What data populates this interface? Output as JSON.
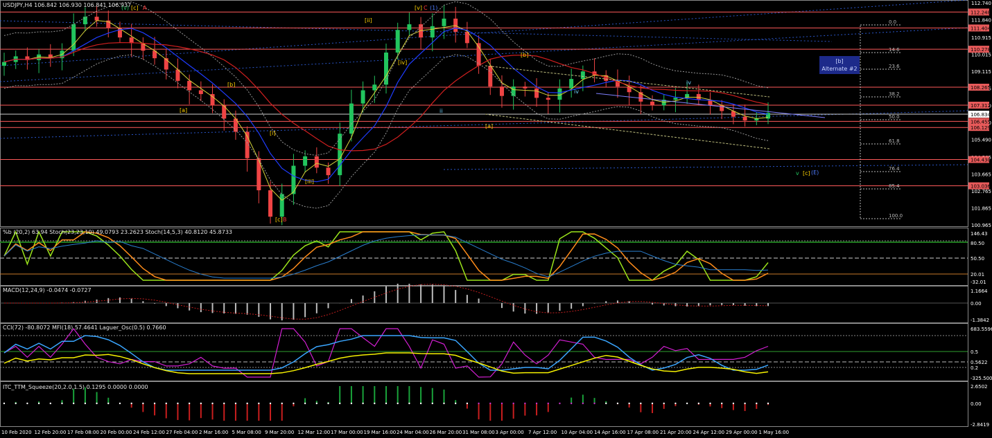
{
  "header": {
    "main": "USDJPY,H4  106.842 106.930 106.841 106.937",
    "rsi": "%b (20,2) 63.94  Stoch(23,23,10) 49.0793 23.2623  Stoch(14,5,3) 40.8120 45.8733",
    "macd": "MACD(12,24,9) -0.0474 -0.0727",
    "cci": "CCI(72) -80.8072  MFI(18) 57.4641  Laguer_Osc(0.5) 0.7660",
    "ttm": "ITC_TTM_Squeeze(20,2.0,1.5) 0.1295 0.0000 0.0000"
  },
  "colors": {
    "background": "#000000",
    "candle_up": "#22c55e",
    "candle_down": "#ef4444",
    "resistance_line": "#ff5a5a",
    "ma_red": "#d11f1f",
    "ma_blue": "#1f3cff",
    "ma_yellow": "#d6d23a",
    "stoch_green": "#9be41b",
    "stoch_orange": "#ff8c1a",
    "macd_hist": "#bdbdbd",
    "cci_magenta": "#d21fd2",
    "mfi_blue": "#3aa6ff",
    "lag_yellow": "#f7f200",
    "ttm_green": "#19a33a",
    "ttm_red": "#c91e1e"
  },
  "price_axis": {
    "ticks": [
      "112.740",
      "111.840",
      "110.915",
      "110.015",
      "109.115",
      "108.215",
      "107.290",
      "106.390",
      "105.490",
      "104.565",
      "103.665",
      "102.765",
      "101.865",
      "100.965"
    ],
    "range": [
      100.965,
      112.74
    ],
    "level_labels": [
      {
        "price": 112.248,
        "text": "112.248",
        "kind": "res"
      },
      {
        "price": 111.404,
        "text": "111.404",
        "kind": "res"
      },
      {
        "price": 110.278,
        "text": "110.278",
        "kind": "res"
      },
      {
        "price": 108.265,
        "text": "108.265",
        "kind": "res"
      },
      {
        "price": 107.312,
        "text": "107.312",
        "kind": "res"
      },
      {
        "price": 106.834,
        "text": "106.834",
        "kind": "cur"
      },
      {
        "price": 106.455,
        "text": "106.455",
        "kind": "res"
      },
      {
        "price": 106.129,
        "text": "106.129",
        "kind": "res"
      },
      {
        "price": 104.43,
        "text": "104.430",
        "kind": "res"
      },
      {
        "price": 103.036,
        "text": "103.036",
        "kind": "res"
      }
    ]
  },
  "time_axis": [
    "10 Feb 2020",
    "12 Feb 20:00",
    "17 Feb 08:00",
    "20 Feb 00:00",
    "24 Feb 12:00",
    "27 Feb 04:00",
    "2 Mar 16:00",
    "5 Mar 08:00",
    "9 Mar 20:00",
    "12 Mar 12:00",
    "17 Mar 00:00",
    "19 Mar 16:00",
    "24 Mar 04:00",
    "26 Mar 20:00",
    "31 Mar 08:00",
    "3 Apr 00:00",
    "7 Apr 12:00",
    "10 Apr 04:00",
    "14 Apr 16:00",
    "17 Apr 08:00",
    "21 Apr 20:00",
    "24 Apr 12:00",
    "29 Apr 00:00",
    "1 May 16:00"
  ],
  "fib_levels": [
    "0.0",
    "14.6",
    "23.6",
    "38.2",
    "50.0",
    "61.8",
    "76.4",
    "85.4",
    "100.0"
  ],
  "alternate_box": {
    "line1": "[b]",
    "line2": "Alternate #2"
  },
  "wave_labels": [
    {
      "text": "(v)",
      "color": "green"
    },
    {
      "text": "[c]",
      "color": "yellow"
    },
    {
      "text": "A",
      "color": "red"
    },
    {
      "text": "[v]",
      "color": "yellow"
    },
    {
      "text": "C",
      "color": "red"
    },
    {
      "text": "(1)",
      "color": "blue"
    },
    {
      "text": "[ii]",
      "color": "yellow"
    },
    {
      "text": "[iv]",
      "color": "yellow"
    },
    {
      "text": "[b]",
      "color": "yellow"
    },
    {
      "text": "[a]",
      "color": "yellow"
    },
    {
      "text": "[b]",
      "color": "yellow"
    },
    {
      "text": "[i]",
      "color": "yellow"
    },
    {
      "text": "[iii]",
      "color": "yellow"
    },
    {
      "text": "[c]",
      "color": "yellow"
    },
    {
      "text": "B",
      "color": "red"
    },
    {
      "text": "[a]",
      "color": "yellow"
    },
    {
      "text": "v",
      "color": "green"
    },
    {
      "text": "[c]",
      "color": "yellow"
    },
    {
      "text": "(E)",
      "color": "blue"
    },
    {
      "text": "iv",
      "color": "cyan"
    },
    {
      "text": "ii",
      "color": "cyan"
    },
    {
      "text": "iv",
      "color": "cyan"
    }
  ],
  "rsi_axis": [
    "146.43",
    "80.50",
    "50.50",
    "20.01",
    "-32.01"
  ],
  "macd_axis": [
    "1.1664",
    "0.00",
    "-1.3842"
  ],
  "cci_axis": [
    "683.5596",
    "0.5",
    "0.5622",
    "0.2",
    "-325.5002"
  ],
  "ttm_axis": [
    "2.6502",
    "0.00",
    "-2.8419"
  ],
  "chart_data": {
    "type": "candlestick",
    "title": "USDJPY,H4",
    "series_close": [
      109.6,
      109.9,
      109.7,
      110.0,
      109.8,
      110.2,
      111.6,
      112.0,
      111.8,
      111.4,
      110.9,
      110.6,
      110.2,
      109.8,
      109.2,
      108.6,
      108.1,
      107.9,
      107.3,
      106.6,
      105.9,
      104.5,
      102.8,
      101.4,
      102.6,
      104.1,
      104.6,
      104.0,
      103.6,
      105.8,
      107.4,
      108.1,
      108.4,
      110.1,
      111.3,
      111.6,
      110.9,
      111.5,
      111.9,
      111.2,
      110.6,
      109.4,
      108.3,
      107.8,
      108.3,
      108.2,
      107.7,
      107.6,
      108.2,
      108.7,
      109.1,
      108.9,
      108.6,
      108.3,
      108.0,
      107.5,
      107.3,
      107.6,
      107.7,
      107.9,
      107.6,
      107.3,
      107.0,
      106.7,
      106.5,
      106.6,
      106.9
    ],
    "ylim": [
      100.965,
      112.74
    ]
  }
}
